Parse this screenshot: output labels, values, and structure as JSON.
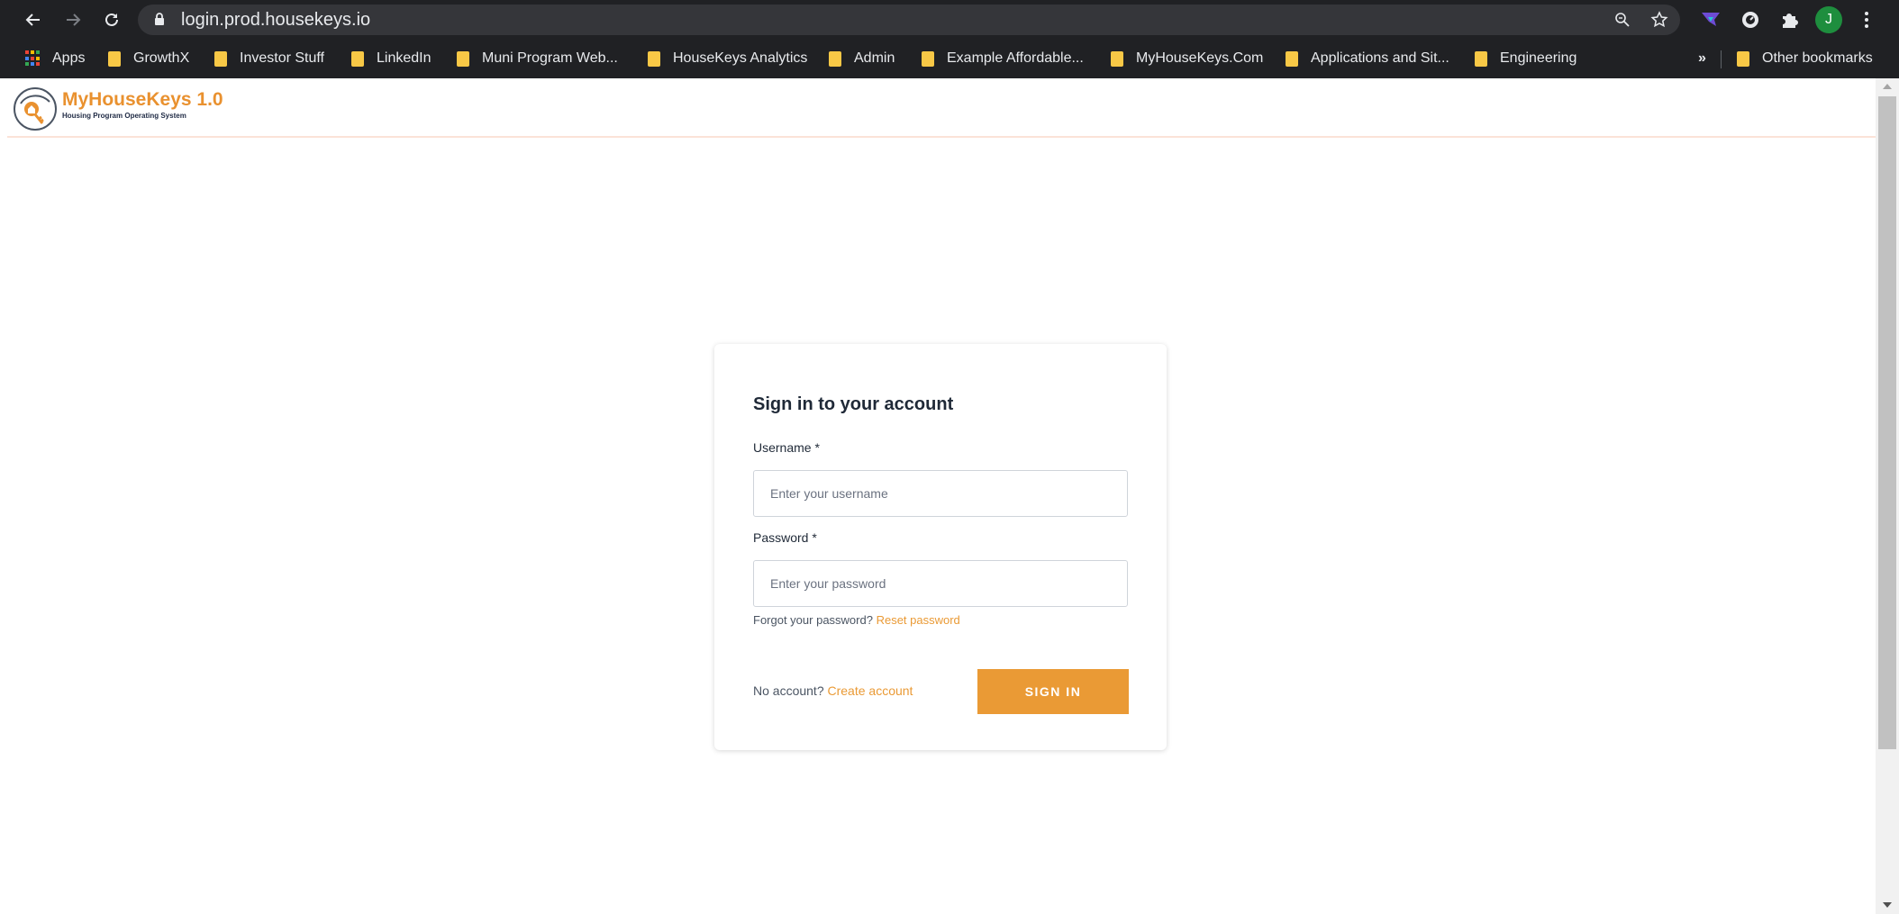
{
  "browser": {
    "url": "login.prod.housekeys.io",
    "avatar_letter": "J",
    "icons": [
      "back-icon",
      "forward-icon",
      "reload-icon",
      "lock-icon",
      "zoom-icon",
      "star-icon",
      "extension-icon",
      "puzzle-icon",
      "menu-icon"
    ],
    "bookmarks": {
      "apps": "Apps",
      "items": [
        "GrowthX",
        "Investor Stuff",
        "LinkedIn",
        "Muni Program Web...",
        "HouseKeys Analytics",
        "Admin",
        "Example Affordable...",
        "MyHouseKeys.Com",
        "Applications and Sit...",
        "Engineering"
      ],
      "overflow": "»",
      "other": "Other bookmarks"
    }
  },
  "app": {
    "logo_title": "MyHouseKeys 1.0",
    "logo_subtitle": "Housing Program Operating System"
  },
  "login": {
    "title": "Sign in to your account",
    "username_label": "Username *",
    "username_placeholder": "Enter your username",
    "username_value": "",
    "password_label": "Password *",
    "password_placeholder": "Enter your password",
    "password_value": "",
    "forgot_text": "Forgot your password?",
    "reset_link": "Reset password",
    "no_account_text": "No account?",
    "create_link": "Create account",
    "submit_label": "SIGN IN"
  },
  "colors": {
    "accent": "#ea9a35",
    "chrome": "#202124",
    "folder": "#f8c846",
    "avatar": "#1e8e3e"
  }
}
